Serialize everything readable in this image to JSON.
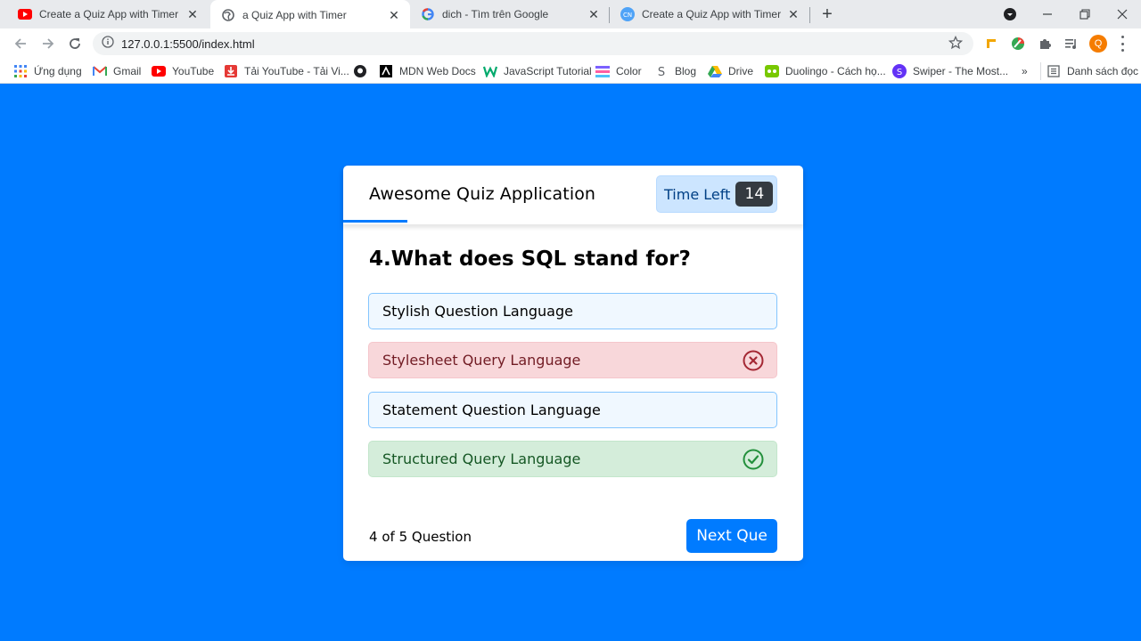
{
  "browser": {
    "tabs": [
      {
        "title": "Create a Quiz App with Timer usi",
        "favicon": "youtube-icon"
      },
      {
        "title": "a Quiz App with Timer",
        "favicon": "globe-icon",
        "active": true
      },
      {
        "title": "dich - Tìm trên Google",
        "favicon": "google-icon"
      },
      {
        "title": "Create a Quiz App with Timer usi",
        "favicon": "codingnepal-icon"
      }
    ],
    "url": "127.0.0.1:5500/index.html",
    "profile_initial": "Q",
    "bookmarks": [
      {
        "label": "Ứng dụng",
        "icon": "apps-grid-icon"
      },
      {
        "label": "Gmail",
        "icon": "gmail-icon"
      },
      {
        "label": "YouTube",
        "icon": "youtube-icon"
      },
      {
        "label": "Tải YouTube - Tải Vi...",
        "icon": "download-icon"
      },
      {
        "label": "",
        "icon": "github-icon"
      },
      {
        "label": "MDN Web Docs",
        "icon": "mdn-icon"
      },
      {
        "label": "JavaScript Tutorial",
        "icon": "w3-icon"
      },
      {
        "label": "Color",
        "icon": "color-icon"
      },
      {
        "label": "Blog",
        "icon": "blog-icon"
      },
      {
        "label": "Drive",
        "icon": "drive-icon"
      },
      {
        "label": "Duolingo - Cách họ...",
        "icon": "duolingo-icon"
      },
      {
        "label": "Swiper - The Most...",
        "icon": "swiper-icon"
      }
    ],
    "more_bookmarks": "»",
    "reading_list": "Danh sách đọc"
  },
  "quiz": {
    "title": "Awesome Quiz Application",
    "timer_label": "Time Left",
    "timer_seconds": "14",
    "timer_progress_fraction": 0.14,
    "question": "4.What does SQL stand for?",
    "options": [
      {
        "text": "Stylish Question Language",
        "state": "neutral"
      },
      {
        "text": "Stylesheet Query Language",
        "state": "wrong"
      },
      {
        "text": "Statement Question Language",
        "state": "neutral"
      },
      {
        "text": "Structured Query Language",
        "state": "correct"
      }
    ],
    "counter": {
      "current": "4",
      "of": "of",
      "total": "5",
      "label": "Question"
    },
    "next_button": "Next Que"
  },
  "colors": {
    "page_bg": "#007bff",
    "accent": "#007bff",
    "wrong": "#dc3545",
    "correct": "#28a745"
  }
}
